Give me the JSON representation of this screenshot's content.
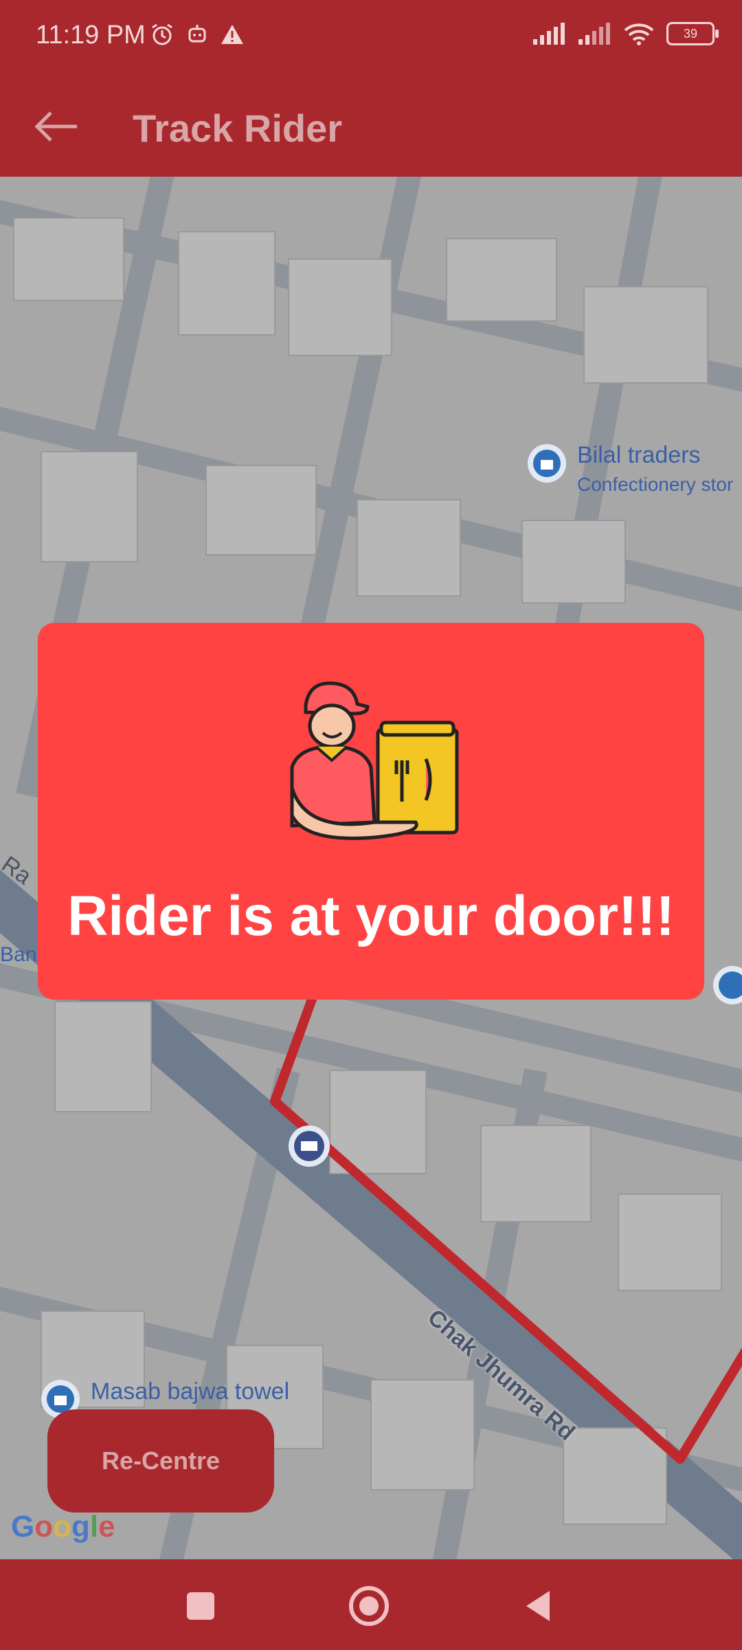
{
  "status": {
    "time": "11:19 PM",
    "battery": "39",
    "icons": [
      "alarm-icon",
      "bot-icon",
      "warning-icon",
      "signal-icon",
      "signal-icon",
      "wifi-icon",
      "battery-icon"
    ]
  },
  "appbar": {
    "title": "Track Rider",
    "back_icon": "arrow-left-icon"
  },
  "map": {
    "pois": [
      {
        "name": "Bilal traders",
        "sub": "Confectionery stor"
      },
      {
        "name": "Masab bajwa towel",
        "sub": ""
      }
    ],
    "road_label": "Chak Jhumra Rd",
    "partial_labels": [
      "Ra",
      "Bank"
    ],
    "brand": "Google"
  },
  "popup": {
    "message": "Rider is at your door!!!",
    "illustration": "delivery-rider-illustration"
  },
  "recentre": {
    "label": "Re-Centre"
  },
  "nav": {
    "icons": [
      "recents-square-icon",
      "home-circle-icon",
      "back-triangle-icon"
    ]
  },
  "colors": {
    "primary": "#a9282d",
    "popup": "#ff4242",
    "route": "#c0282d"
  }
}
